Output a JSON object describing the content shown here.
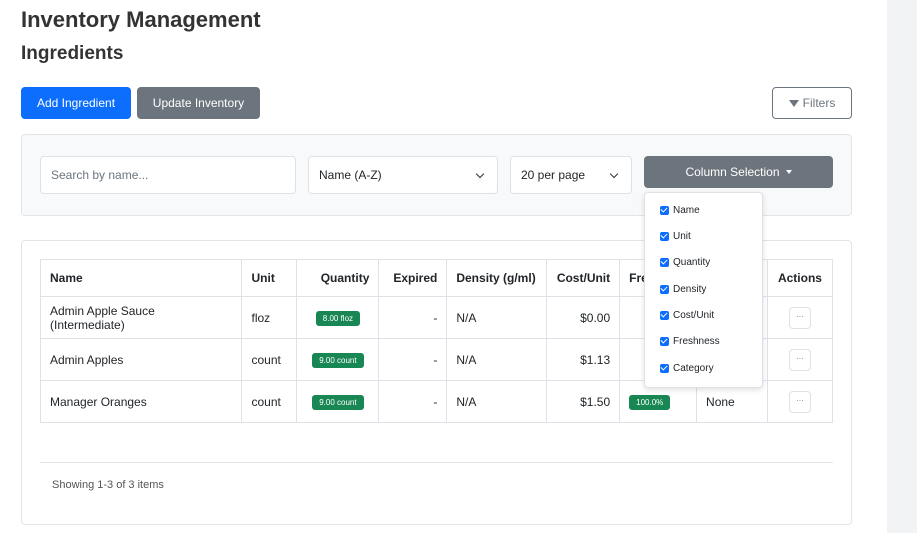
{
  "header": {
    "title": "Inventory Management",
    "section": "Ingredients"
  },
  "toolbar": {
    "add_label": "Add Ingredient",
    "update_label": "Update Inventory",
    "filters_label": "Filters"
  },
  "filters": {
    "search_placeholder": "Search by name...",
    "sort_value": "Name (A-Z)",
    "per_page_value": "20 per page",
    "column_selection_label": "Column Selection"
  },
  "column_menu": {
    "items": [
      {
        "label": "Name",
        "checked": true
      },
      {
        "label": "Unit",
        "checked": true
      },
      {
        "label": "Quantity",
        "checked": true
      },
      {
        "label": "Density",
        "checked": true
      },
      {
        "label": "Cost/Unit",
        "checked": true
      },
      {
        "label": "Freshness",
        "checked": true
      },
      {
        "label": "Category",
        "checked": true
      }
    ]
  },
  "table": {
    "headers": [
      "Name",
      "Unit",
      "Quantity",
      "Expired",
      "Density (g/ml)",
      "Cost/Unit",
      "Fre",
      "",
      "Actions"
    ],
    "rows": [
      {
        "name": "Admin Apple Sauce (Intermediate)",
        "unit": "floz",
        "quantity": "8.00 floz",
        "expired": "-",
        "density": "N/A",
        "cost": "$0.00",
        "freshness": "",
        "category": "",
        "actions": "···"
      },
      {
        "name": "Admin Apples",
        "unit": "count",
        "quantity": "9.00 count",
        "expired": "-",
        "density": "N/A",
        "cost": "$1.13",
        "freshness": "",
        "category": "",
        "actions": "···"
      },
      {
        "name": "Manager Oranges",
        "unit": "count",
        "quantity": "9.00 count",
        "expired": "-",
        "density": "N/A",
        "cost": "$1.50",
        "freshness": "100.0%",
        "category": "None",
        "actions": "···"
      }
    ]
  },
  "footer": {
    "showing": "Showing 1-3 of 3 items"
  },
  "colors": {
    "primary": "#0d6efd",
    "secondary": "#6c757d",
    "success": "#198754"
  }
}
